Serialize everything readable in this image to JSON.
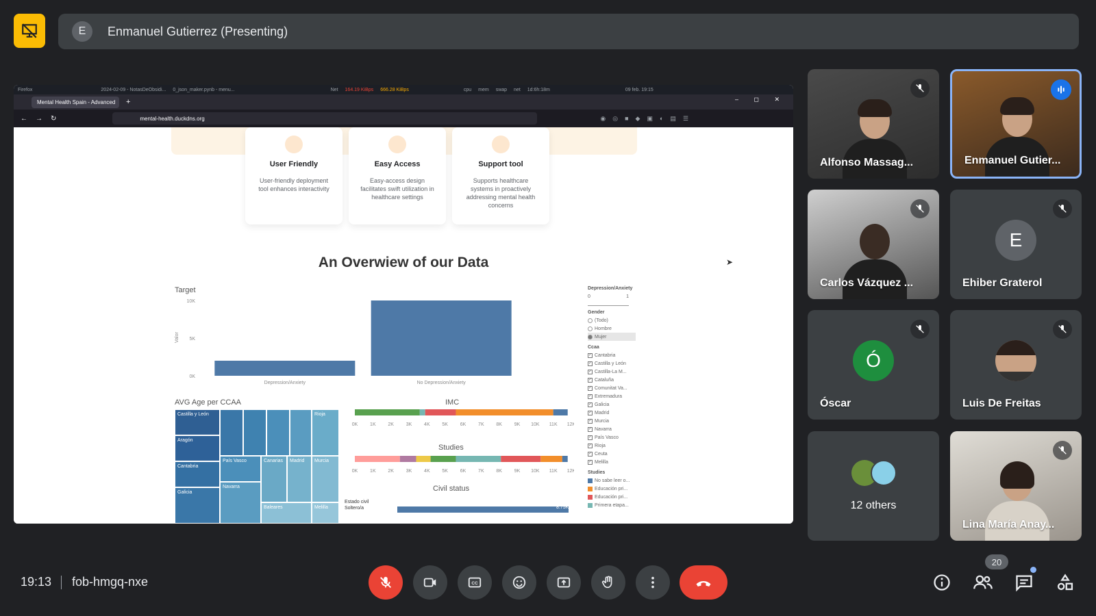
{
  "presenter": {
    "avatar_letter": "E",
    "banner": "Enmanuel Gutierrez (Presenting)"
  },
  "browser": {
    "os_bar": {
      "firefox_label": "Firefox",
      "item2": "2024-02-09 - NotasDeObsidi...",
      "item3": "0_json_maker.pynb - menu...",
      "net_label": "Net",
      "net_down": "164.19 KiBps",
      "net_up": "666.28 KiBps",
      "sys_items": [
        "cpu",
        "mem",
        "swap",
        "net",
        "1d:6h:18m"
      ],
      "datetime": "09 feb. 19:15"
    },
    "tab_title": "Mental Health Spain - Advanced",
    "url": "mental-health.duckdns.org"
  },
  "page": {
    "features": [
      {
        "title": "User Friendly",
        "desc": "User-friendly deployment tool enhances interactivity"
      },
      {
        "title": "Easy Access",
        "desc": "Easy-access design facilitates swift utilization in healthcare settings"
      },
      {
        "title": "Support tool",
        "desc": "Supports healthcare systems in proactively addressing mental health concerns"
      }
    ],
    "overview_title": "An Overwiew of our Data"
  },
  "chart_data": [
    {
      "type": "bar",
      "title": "Target",
      "ylabel": "Valor",
      "categories": [
        "Depression/Anxiety",
        "No Depression/Anxiety"
      ],
      "values": [
        2000,
        10000
      ],
      "ylim": [
        0,
        10000
      ],
      "yticks": [
        "10K",
        "5K",
        "0K"
      ],
      "color": "#4e79a7"
    },
    {
      "type": "heatmap",
      "title": "AVG Age per CCAA",
      "labels": [
        "Castilla y León",
        "Rioja",
        "Aragón",
        "País Vasco",
        "Canarias",
        "Madrid",
        "Murcia",
        "Cantabria",
        "Navarra",
        "Galicia",
        "Baleares",
        "Melilla"
      ]
    },
    {
      "type": "bar",
      "title": "IMC",
      "xticks": [
        "0K",
        "1K",
        "2K",
        "3K",
        "4K",
        "5K",
        "6K",
        "7K",
        "8K",
        "9K",
        "10K",
        "11K",
        "12K"
      ],
      "segments": [
        {
          "color": "#59a14f",
          "value": 3.6
        },
        {
          "color": "#76b7b2",
          "value": 0.3
        },
        {
          "color": "#e15759",
          "value": 1.7
        },
        {
          "color": "#f28e2b",
          "value": 5.4
        },
        {
          "color": "#4e79a7",
          "value": 0.8
        }
      ]
    },
    {
      "type": "bar",
      "title": "Studies",
      "xticks": [
        "0K",
        "1K",
        "2K",
        "3K",
        "4K",
        "5K",
        "6K",
        "7K",
        "8K",
        "9K",
        "10K",
        "11K",
        "12K"
      ],
      "segments": [
        {
          "color": "#ff9d9a",
          "value": 2.5
        },
        {
          "color": "#b07aa1",
          "value": 0.9
        },
        {
          "color": "#edc948",
          "value": 0.8
        },
        {
          "color": "#59a14f",
          "value": 1.4
        },
        {
          "color": "#76b7b2",
          "value": 2.5
        },
        {
          "color": "#e15759",
          "value": 2.2
        },
        {
          "color": "#f28e2b",
          "value": 1.2
        },
        {
          "color": "#4e79a7",
          "value": 0.3
        }
      ]
    },
    {
      "type": "bar",
      "title": "Civil status",
      "column_header": "Estado civil",
      "row_label": "Soltero/a",
      "value_label": "8.75K"
    }
  ],
  "filters": {
    "depression_title": "Depression/Anxiety",
    "slider_min": "0",
    "slider_max": "1",
    "gender_title": "Gender",
    "gender_options": [
      "(Todo)",
      "Hombre",
      "Mujer"
    ],
    "gender_selected": "Mujer",
    "ccaa_title": "Ccaa",
    "ccaa": [
      "Cantabria",
      "Castilla y León",
      "Castilla-La M...",
      "Cataluña",
      "Comunitat Va...",
      "Extremadura",
      "Galicia",
      "Madrid",
      "Murcia",
      "Navarra",
      "País Vasco",
      "Rioja",
      "Ceuta",
      "Melilla"
    ],
    "studies_title": "Studies",
    "studies": [
      {
        "label": "No sabe leer o...",
        "color": "#4e79a7"
      },
      {
        "label": "Educación pri...",
        "color": "#f28e2b"
      },
      {
        "label": "Educación pri...",
        "color": "#e15759"
      },
      {
        "label": "Primera etapa...",
        "color": "#76b7b2"
      }
    ]
  },
  "participants": [
    {
      "name": "Alfonso Massag...",
      "muted": true
    },
    {
      "name": "Enmanuel Gutier...",
      "speaking": true
    },
    {
      "name": "Carlos Vázquez ...",
      "muted": true
    },
    {
      "name": "Ehiber Graterol",
      "avatar_letter": "E",
      "muted": true
    },
    {
      "name": "Óscar",
      "avatar_letter": "Ó",
      "avatar_color": "#1e8e3e",
      "muted": true
    },
    {
      "name": "Luis De Freitas",
      "muted": true
    },
    {
      "name": "12 others"
    },
    {
      "name": "Lina María Anay...",
      "muted": true
    }
  ],
  "bottom": {
    "time": "19:13",
    "meeting_code": "fob-hmgq-nxe",
    "participant_count": "20"
  }
}
